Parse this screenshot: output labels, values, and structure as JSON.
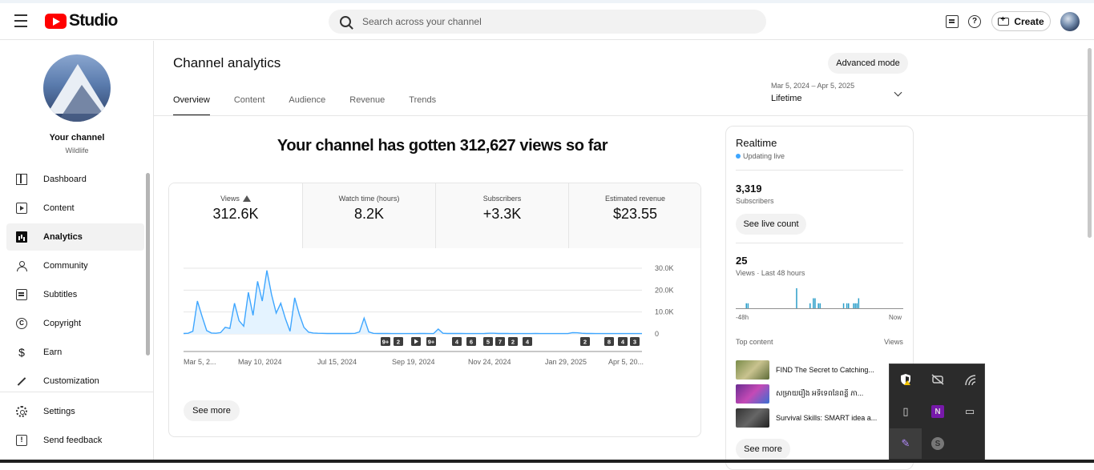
{
  "header": {
    "logo_text": "Studio",
    "search_placeholder": "Search across your channel",
    "help_glyph": "?",
    "create_label": "Create"
  },
  "sidebar": {
    "channel_name": "Your channel",
    "channel_category": "Wildlife",
    "items": [
      {
        "label": "Dashboard",
        "icon": "dashboard-icon"
      },
      {
        "label": "Content",
        "icon": "content-icon"
      },
      {
        "label": "Analytics",
        "icon": "analytics-icon",
        "active": true
      },
      {
        "label": "Community",
        "icon": "community-icon"
      },
      {
        "label": "Subtitles",
        "icon": "subtitles-icon"
      },
      {
        "label": "Copyright",
        "icon": "copyright-icon"
      },
      {
        "label": "Earn",
        "icon": "earn-icon"
      },
      {
        "label": "Customization",
        "icon": "customization-icon"
      }
    ],
    "bottom": [
      {
        "label": "Settings",
        "icon": "settings-icon"
      },
      {
        "label": "Send feedback",
        "icon": "feedback-icon"
      }
    ],
    "copyright_glyph": "C",
    "earn_glyph": "$",
    "feedback_glyph": "!"
  },
  "main": {
    "title": "Channel analytics",
    "advanced_mode": "Advanced mode",
    "tabs": [
      "Overview",
      "Content",
      "Audience",
      "Revenue",
      "Trends"
    ],
    "date_range": "Mar 5, 2024 – Apr 5, 2025",
    "date_label": "Lifetime",
    "headline": "Your channel has gotten 312,627 views so far",
    "metrics": [
      {
        "label": "Views",
        "value": "312.6K"
      },
      {
        "label": "Watch time (hours)",
        "value": "8.2K"
      },
      {
        "label": "Subscribers",
        "value": "+3.3K"
      },
      {
        "label": "Estimated revenue",
        "value": "$23.55"
      }
    ],
    "see_more": "See more"
  },
  "chart_data": {
    "type": "line",
    "title": "",
    "xlabel": "",
    "ylabel": "",
    "ylim": [
      0,
      30000
    ],
    "y_ticks": [
      "0",
      "10.0K",
      "20.0K",
      "30.0K"
    ],
    "x_tick_labels": [
      "Mar 5, 2...",
      "May 10, 2024",
      "Jul 15, 2024",
      "Sep 19, 2024",
      "Nov 24, 2024",
      "Jan 29, 2025",
      "Apr 5, 20..."
    ],
    "series": [
      {
        "values": [
          200,
          300,
          1200,
          15000,
          8000,
          1500,
          400,
          300,
          600,
          3000,
          2500,
          14000,
          6000,
          3500,
          19000,
          8500,
          24000,
          15000,
          29000,
          18000,
          9500,
          14000,
          7000,
          1200,
          16500,
          9000,
          3000,
          800,
          400,
          300,
          250,
          200,
          200,
          180,
          180,
          170,
          200,
          250,
          900,
          7200,
          900,
          250,
          200,
          180,
          170,
          160,
          160,
          160,
          150,
          150,
          160,
          170,
          180,
          160,
          150,
          2200,
          300,
          200,
          180,
          170,
          170,
          160,
          160,
          160,
          150,
          170,
          300,
          280,
          200,
          180,
          170,
          160,
          150,
          150,
          160,
          160,
          170,
          160,
          150,
          150,
          160,
          160,
          150,
          150,
          600,
          500,
          300,
          200,
          180,
          160,
          150,
          150,
          150,
          150,
          150,
          160,
          150,
          140,
          150,
          150
        ]
      }
    ],
    "markers": [
      "9+",
      "2",
      "play",
      "9+",
      "4",
      "6",
      "5",
      "7",
      "2",
      "4",
      "2",
      "8",
      "4",
      "3"
    ],
    "colors": {
      "line": "#3ea6ff",
      "fill": "#e4f3ff",
      "grid": "#e5e5e5"
    }
  },
  "realtime": {
    "title": "Realtime",
    "live_label": "Updating live",
    "subscribers_value": "3,319",
    "subscribers_label": "Subscribers",
    "see_live_count": "See live count",
    "views_value": "25",
    "views_label": "Views · Last 48 hours",
    "bars": [
      0,
      0,
      0,
      0,
      0,
      0,
      1,
      1,
      0,
      0,
      0,
      0,
      0,
      0,
      0,
      0,
      0,
      0,
      0,
      0,
      0,
      0,
      0,
      0,
      0,
      0,
      0,
      0,
      0,
      0,
      0,
      0,
      0,
      0,
      0,
      0,
      4,
      0,
      0,
      0,
      0,
      0,
      0,
      0,
      1,
      0,
      2,
      2,
      0,
      1,
      1,
      0,
      0,
      0,
      0,
      0,
      0,
      0,
      0,
      0,
      0,
      0,
      0,
      0,
      1,
      0,
      1,
      1,
      0,
      0,
      1,
      1,
      1,
      2,
      0,
      0,
      0,
      0,
      0,
      0,
      0,
      0,
      0,
      0,
      0,
      0,
      0,
      0,
      0,
      0,
      0,
      0,
      0,
      0,
      0,
      0,
      0,
      0,
      0,
      0
    ],
    "axis_start": "-48h",
    "axis_end": "Now",
    "top_content_label": "Top content",
    "top_content_views": "Views",
    "top_content": [
      {
        "title": "FIND The Secret to Catching..."
      },
      {
        "title": "សម្រាយរឿង អទិទេពនៃពន្លឺ ភា..."
      },
      {
        "title": "Survival Skills: SMART idea a..."
      }
    ],
    "see_more": "See more"
  },
  "tray": {
    "icons": [
      "defender-warning-icon",
      "notifications-off-icon",
      "wifi-icon",
      "usb-drive-icon",
      "onenote-clip-icon",
      "battery-icon",
      "feather-pen-icon",
      "skype-icon"
    ],
    "glyphs": {
      "usb": "▯",
      "onenote": "N",
      "battery": "▭",
      "pen": "✎",
      "skype": "S"
    }
  }
}
